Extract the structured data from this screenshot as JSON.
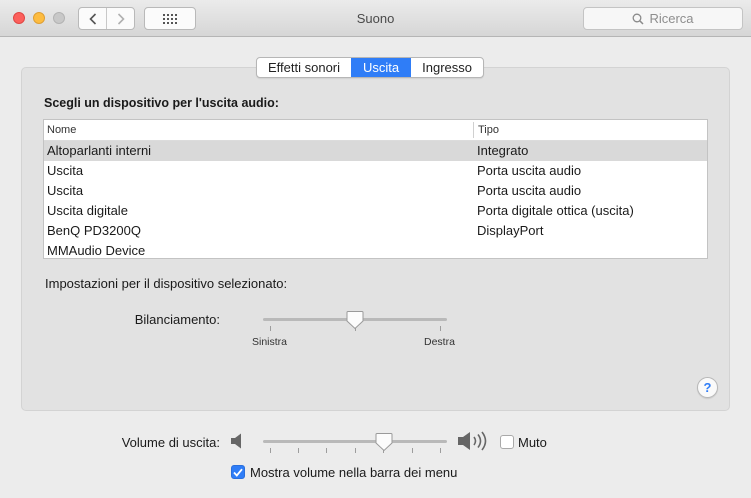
{
  "window": {
    "title": "Suono",
    "search_placeholder": "Ricerca"
  },
  "tabs": [
    {
      "label": "Effetti sonori",
      "active": false
    },
    {
      "label": "Uscita",
      "active": true
    },
    {
      "label": "Ingresso",
      "active": false
    }
  ],
  "output": {
    "heading": "Scegli un dispositivo per l'uscita audio:",
    "columns": [
      "Nome",
      "Tipo"
    ],
    "devices": [
      {
        "name": "Altoparlanti interni",
        "type": "Integrato",
        "selected": true
      },
      {
        "name": "Uscita",
        "type": "Porta uscita audio",
        "selected": false
      },
      {
        "name": "Uscita",
        "type": "Porta uscita audio",
        "selected": false
      },
      {
        "name": "Uscita digitale",
        "type": "Porta digitale ottica (uscita)",
        "selected": false
      },
      {
        "name": "BenQ PD3200Q",
        "type": "DisplayPort",
        "selected": false
      },
      {
        "name": "MMAudio Device",
        "type": "",
        "selected": false
      }
    ],
    "settings_heading": "Impostazioni per il dispositivo selezionato:",
    "balance": {
      "label": "Bilanciamento:",
      "left_label": "Sinistra",
      "right_label": "Destra",
      "value": 0.5
    }
  },
  "volume": {
    "label": "Volume di uscita:",
    "value": 0.67,
    "mute_label": "Muto",
    "mute_checked": false,
    "show_in_menubar_label": "Mostra volume nella barra dei menu",
    "show_in_menubar_checked": true
  },
  "colors": {
    "accent": "#2f7df7",
    "selection_row": "#d9d9d9"
  },
  "icons": {
    "back": "chevron-left-icon",
    "forward": "chevron-right-icon",
    "show_all": "grid-icon",
    "search": "search-icon",
    "help": "help-icon",
    "volume_low": "speaker-low-icon",
    "volume_high": "speaker-high-icon"
  }
}
